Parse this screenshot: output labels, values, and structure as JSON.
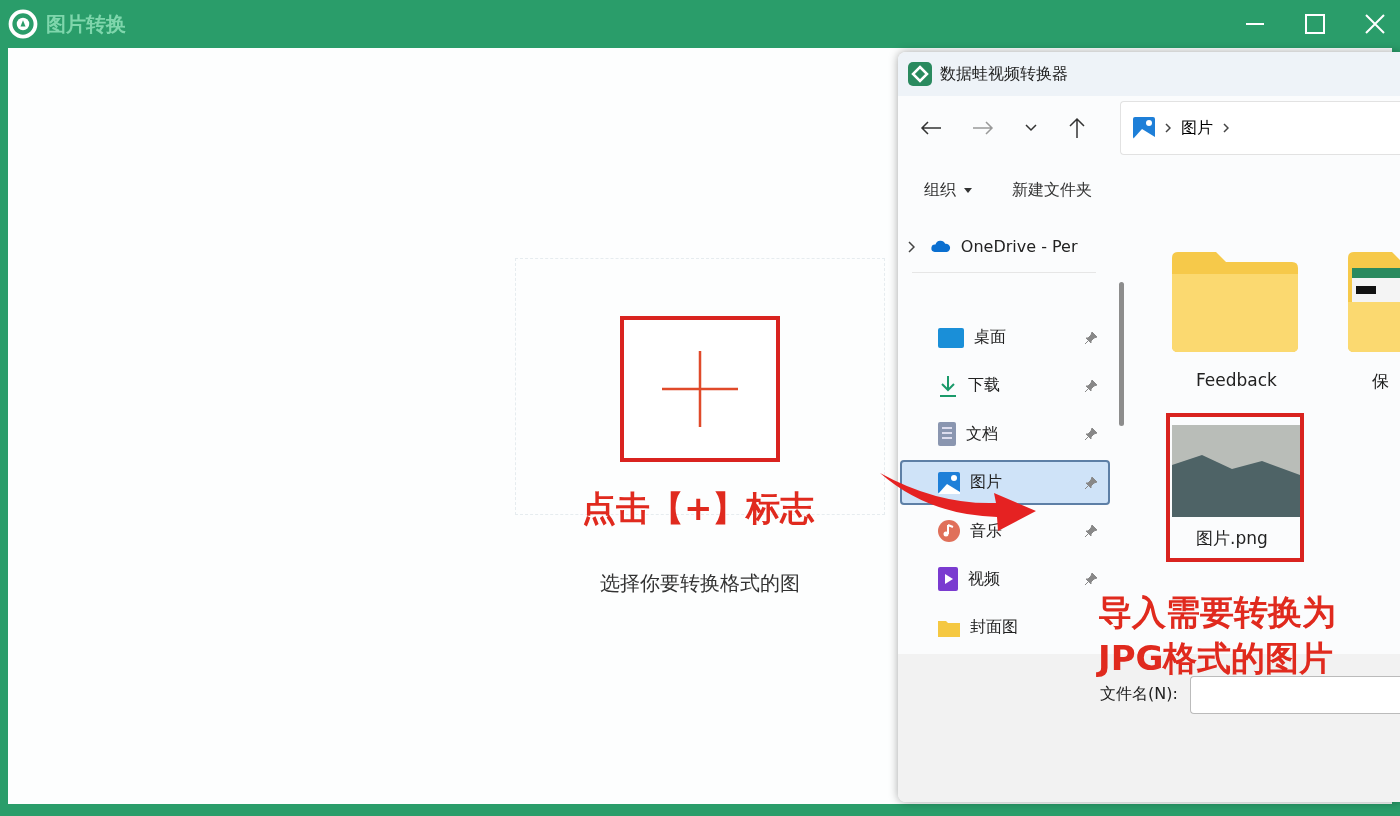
{
  "window": {
    "title": "图片转换"
  },
  "upload": {
    "hint": "选择你要转换格式的图"
  },
  "dialog": {
    "title": "数据蛙视频转换器",
    "address": [
      "图片"
    ],
    "commands": [
      {
        "label": "组织",
        "dropdown": true
      },
      {
        "label": "新建文件夹",
        "dropdown": false
      }
    ],
    "sidebar": [
      {
        "kind": "cloud",
        "label": "OneDrive - Per",
        "expanded": false,
        "pinned": false,
        "selected": false
      },
      {
        "kind": "desktop",
        "label": "桌面",
        "pinned": true,
        "selected": false
      },
      {
        "kind": "download",
        "label": "下载",
        "pinned": true,
        "selected": false
      },
      {
        "kind": "documents",
        "label": "文档",
        "pinned": true,
        "selected": false
      },
      {
        "kind": "pictures",
        "label": "图片",
        "pinned": true,
        "selected": true
      },
      {
        "kind": "music",
        "label": "音乐",
        "pinned": true,
        "selected": false
      },
      {
        "kind": "videos",
        "label": "视频",
        "pinned": true,
        "selected": false
      },
      {
        "kind": "folder",
        "label": "封面图",
        "pinned": false,
        "selected": false
      }
    ],
    "files": [
      {
        "kind": "folder",
        "name": "Feedback",
        "highlighted": false
      },
      {
        "kind": "folder-doc",
        "name": "保",
        "highlighted": false
      },
      {
        "kind": "image",
        "name": "图片.png",
        "highlighted": true
      }
    ],
    "filename": {
      "label": "文件名(N):"
    }
  },
  "annotations": {
    "add_hint": "点击【+】标志",
    "import_hint": "导入需要转换为\nJPG格式的图片"
  }
}
